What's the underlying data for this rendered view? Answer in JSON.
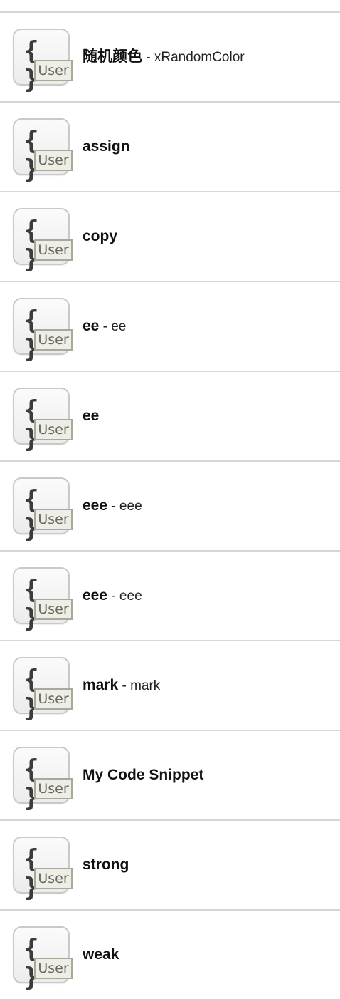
{
  "snippets": [
    {
      "title": "随机颜色",
      "subtitle": " - xRandomColor",
      "icon": "braces-icon",
      "badge": "User"
    },
    {
      "title": "assign",
      "subtitle": "",
      "icon": "braces-icon",
      "badge": "User"
    },
    {
      "title": "copy",
      "subtitle": "",
      "icon": "braces-icon",
      "badge": "User"
    },
    {
      "title": "ee",
      "subtitle": " - ee",
      "icon": "braces-icon",
      "badge": "User"
    },
    {
      "title": "ee",
      "subtitle": "",
      "icon": "braces-icon",
      "badge": "User"
    },
    {
      "title": "eee",
      "subtitle": " - eee",
      "icon": "braces-icon",
      "badge": "User"
    },
    {
      "title": "eee",
      "subtitle": " - eee",
      "icon": "braces-icon",
      "badge": "User"
    },
    {
      "title": "mark",
      "subtitle": " - mark",
      "icon": "braces-icon",
      "badge": "User"
    },
    {
      "title": "My Code Snippet",
      "subtitle": "",
      "icon": "braces-icon",
      "badge": "User"
    },
    {
      "title": "strong",
      "subtitle": "",
      "icon": "braces-icon",
      "badge": "User"
    },
    {
      "title": "weak",
      "subtitle": "",
      "icon": "braces-icon",
      "badge": "User"
    }
  ],
  "icon_glyph": "{ }"
}
